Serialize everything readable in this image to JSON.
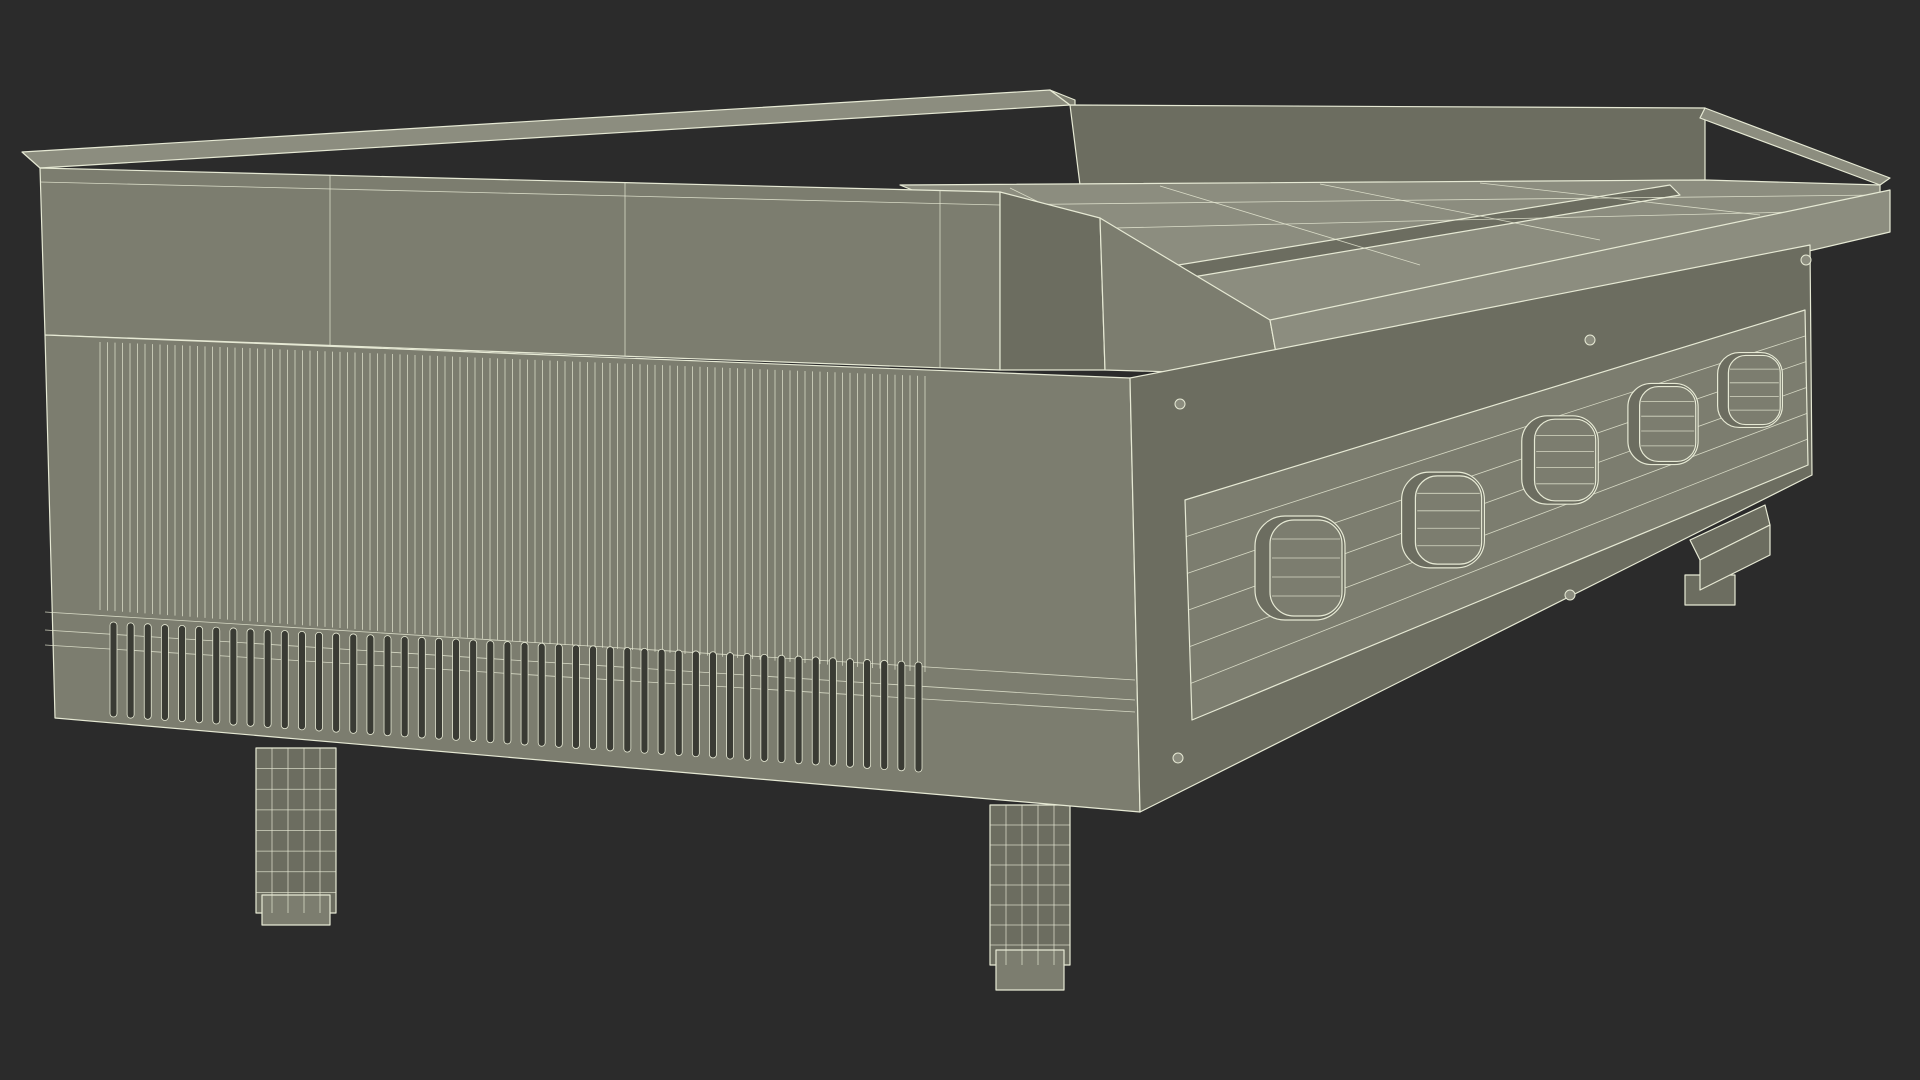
{
  "scene": {
    "background_color": "#2b2b2b",
    "surface_color": "#7c7d6f",
    "surface_shadow_color": "#6c6d60",
    "surface_light_color": "#8c8d7f",
    "wire_color": "#e6e9d4",
    "knob_count": 5,
    "leg_count": 2
  }
}
